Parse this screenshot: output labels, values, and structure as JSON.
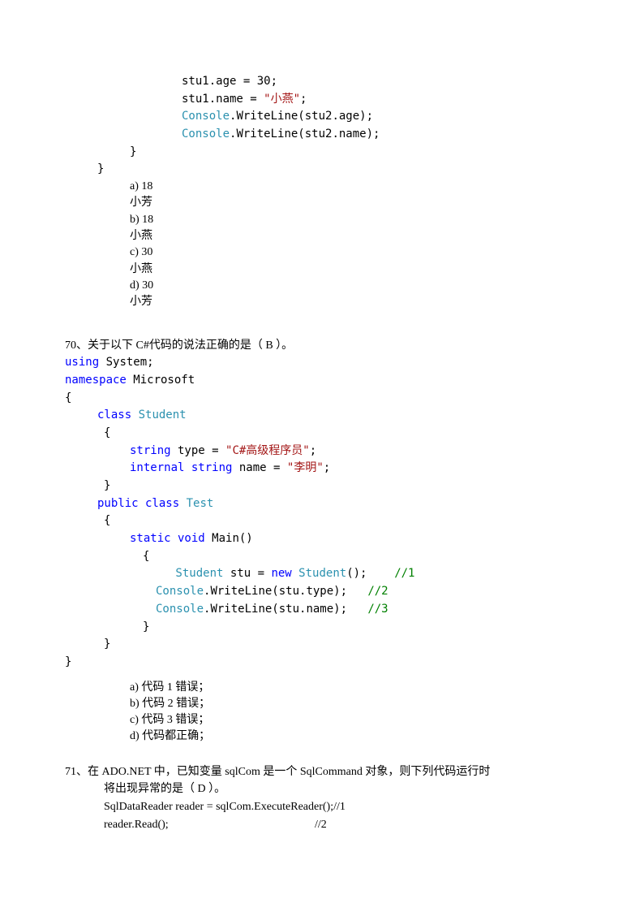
{
  "q69": {
    "code": {
      "l1a": "stu1.age = 30;",
      "l2a": "stu1.name = ",
      "l2b": "\"小燕\"",
      "l2c": ";",
      "l3a": "Console",
      "l3b": ".WriteLine(stu2.age);",
      "l4a": "Console",
      "l4b": ".WriteLine(stu2.name);",
      "l5": "}",
      "l6": "}"
    },
    "opts": {
      "a1": "a) 18",
      "a2": "  小芳",
      "b1": "b) 18",
      "b2": "  小燕",
      "c1": "c) 30",
      "c2": "  小燕",
      "d1": "d) 30",
      "d2": "  小芳"
    }
  },
  "q70": {
    "stem": "70、关于以下 C#代码的说法正确的是（ B ）。",
    "code": {
      "l1a": "using",
      "l1b": " System;",
      "l2a": "namespace",
      "l2b": " Microsoft",
      "l3": "{",
      "l4a": "class",
      "l4b": " Student",
      "l5": "{",
      "l6a": "string",
      "l6b": " type = ",
      "l6c": "\"C#高级程序员\"",
      "l6d": ";",
      "l7a": "internal",
      "l7b": " string",
      "l7c": " name = ",
      "l7d": "\"李明\"",
      "l7e": ";",
      "l8": "}",
      "l9a": "public",
      "l9b": " class",
      "l9c": " Test",
      "l10": "{",
      "l11a": "static",
      "l11b": " void",
      "l11c": " Main()",
      "l12": "{",
      "l13a": " Student",
      "l13b": " stu = ",
      "l13c": "new",
      "l13d": " Student",
      "l13e": "();    ",
      "l13f": "//1",
      "l14a": "Console",
      "l14b": ".WriteLine(stu.type);   ",
      "l14c": "//2",
      "l15a": "Console",
      "l15b": ".WriteLine(stu.name);   ",
      "l15c": "//3",
      "l16": "}",
      "l17": "}",
      "l18": "}"
    },
    "opts": {
      "a": "a)   代码 1 错误；",
      "b": "b)   代码 2 错误；",
      "c": "c)   代码 3 错误；",
      "d": "d)   代码都正确；"
    }
  },
  "q71": {
    "stem1": "71、在 ADO.NET 中，已知变量 sqlCom 是一个 SqlCommand 对象，则下列代码运行时",
    "stem2": "将出现异常的是（ D ）。",
    "code1": "SqlDataReader reader = sqlCom.ExecuteReader();//1",
    "code2a": "reader.Read();",
    "code2b": "//2"
  }
}
